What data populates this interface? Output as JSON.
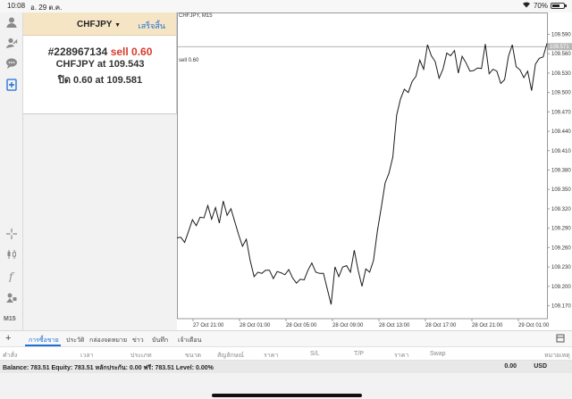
{
  "status_bar": {
    "time": "10:08",
    "date": "อ. 29 ต.ค.",
    "battery": "70%",
    "battery_level": 0.7
  },
  "left_toolbar": {
    "timeframe_label": "M15"
  },
  "order_panel": {
    "symbol": "CHFJPY",
    "done_label": "เสร็จสิ้น",
    "order_id": "#228967134",
    "order_action": "sell 0.60",
    "price_line_prefix": "CHFJPY at",
    "price_line_value": "109.543",
    "close_line_prefix": "ปิด 0.60 at",
    "close_line_value": "109.581"
  },
  "chart_header": {
    "title": "CHFJPY, M15"
  },
  "chart_data": {
    "type": "line",
    "title": "CHFJPY, M15",
    "ylim": [
      109.15,
      109.61
    ],
    "x_labels": [
      "27 Oct 21:00",
      "28 Oct 01:00",
      "28 Oct 05:00",
      "28 Oct 09:00",
      "28 Oct 13:00",
      "28 Oct 17:00",
      "28 Oct 21:00",
      "29 Oct 01:00"
    ],
    "y_ticks": [
      "109.590",
      "109.560",
      "109.530",
      "109.500",
      "109.470",
      "109.440",
      "109.410",
      "109.380",
      "109.350",
      "109.320",
      "109.290",
      "109.260",
      "109.230",
      "109.200",
      "109.170"
    ],
    "current_price": "109.571",
    "order_line": {
      "label": "sell 0.60",
      "value": 109.571
    },
    "series": [
      {
        "values": [
          109.275,
          109.276,
          109.268,
          109.285,
          109.303,
          109.294,
          109.307,
          109.306,
          109.325,
          109.304,
          109.322,
          109.298,
          109.332,
          109.31,
          109.32,
          109.3,
          109.28,
          109.262,
          109.273,
          109.24,
          109.215,
          109.222,
          109.22,
          109.225,
          109.225,
          109.212,
          109.223,
          109.221,
          109.218,
          109.226,
          109.213,
          109.205,
          109.211,
          109.21,
          109.225,
          109.236,
          109.222,
          109.22,
          109.22,
          109.196,
          109.172,
          109.23,
          109.215,
          109.23,
          109.232,
          109.222,
          109.256,
          109.225,
          109.2,
          109.227,
          109.222,
          109.24,
          109.286,
          109.322,
          109.36,
          109.375,
          109.4,
          109.465,
          109.49,
          109.505,
          109.5,
          109.517,
          109.525,
          109.55,
          109.536,
          109.574,
          109.557,
          109.548,
          109.522,
          109.536,
          109.561,
          109.557,
          109.565,
          109.53,
          109.556,
          109.546,
          109.533,
          109.534,
          109.538,
          109.537,
          109.575,
          109.529,
          109.536,
          109.533,
          109.514,
          109.52,
          109.556,
          109.574,
          109.54,
          109.535,
          109.523,
          109.533,
          109.503,
          109.544,
          109.553,
          109.555,
          109.576
        ]
      }
    ]
  },
  "bottom_tabs": {
    "items": [
      "การซื้อขาย",
      "ประวัติ",
      "กล่องจดหมาย",
      "ข่าว",
      "บันทึก",
      "เจ้าเตือน"
    ]
  },
  "columns": {
    "order": "คำสั่ง",
    "time": "เวลา",
    "type": "ประเภท",
    "volume": "ขนาด",
    "symbol": "สัญลักษณ์",
    "price": "ราคา",
    "sl": "S/L",
    "tp": "T/P",
    "price2": "ราคา",
    "swap": "Swap",
    "profit": "",
    "comment": "หมายเหตุ"
  },
  "balance": {
    "summary": "Balance: 783.51 Equity: 783.51 หลักประกัน: 0.00 ฟรี: 783.51 Level: 0.00%",
    "profit": "0.00",
    "currency": "USD"
  }
}
